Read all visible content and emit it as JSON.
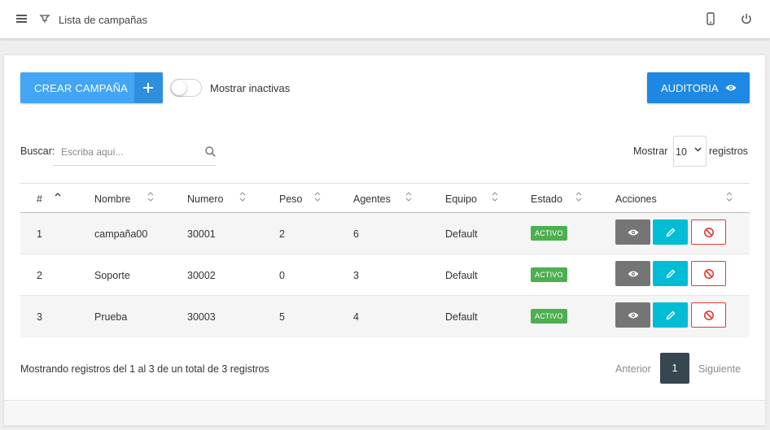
{
  "header": {
    "title": "Lista de campañas",
    "menu_icon": "hamburger-menu-icon",
    "breadcrumb_icon": "campaign-icon",
    "device_icon": "mobile-phone-icon",
    "logout_icon": "power-icon"
  },
  "toolbar": {
    "create_label": "CREAR CAMPAÑA",
    "show_inactive_label": "Mostrar inactivas",
    "show_inactive_on": false,
    "audit_label": "AUDITORIA"
  },
  "search": {
    "label": "Buscar:",
    "placeholder": "Escriba aquí..."
  },
  "length": {
    "prefix": "Mostrar",
    "value": "10",
    "suffix": "registros"
  },
  "table": {
    "columns": [
      "#",
      "Nombre",
      "Numero",
      "Peso",
      "Agentes",
      "Equipo",
      "Estado",
      "Acciones"
    ],
    "rows": [
      {
        "id": "1",
        "nombre": "campaña00",
        "numero": "30001",
        "peso": "2",
        "agentes": "6",
        "equipo": "Default",
        "estado": "ACTIVO"
      },
      {
        "id": "2",
        "nombre": "Soporte",
        "numero": "30002",
        "peso": "0",
        "agentes": "3",
        "equipo": "Default",
        "estado": "ACTIVO"
      },
      {
        "id": "3",
        "nombre": "Prueba",
        "numero": "30003",
        "peso": "5",
        "agentes": "4",
        "equipo": "Default",
        "estado": "ACTIVO"
      }
    ]
  },
  "footer": {
    "info": "Mostrando registros del 1 al 3 de un total de 3 registros",
    "prev": "Anterior",
    "current_page": "1",
    "next": "Siguiente"
  },
  "colors": {
    "primary": "#42a5f5",
    "audit": "#1e88e5",
    "active": "#4caf50",
    "view": "#757575",
    "edit": "#00bcd4",
    "disable": "#e53935",
    "pagination": "#37474f"
  }
}
